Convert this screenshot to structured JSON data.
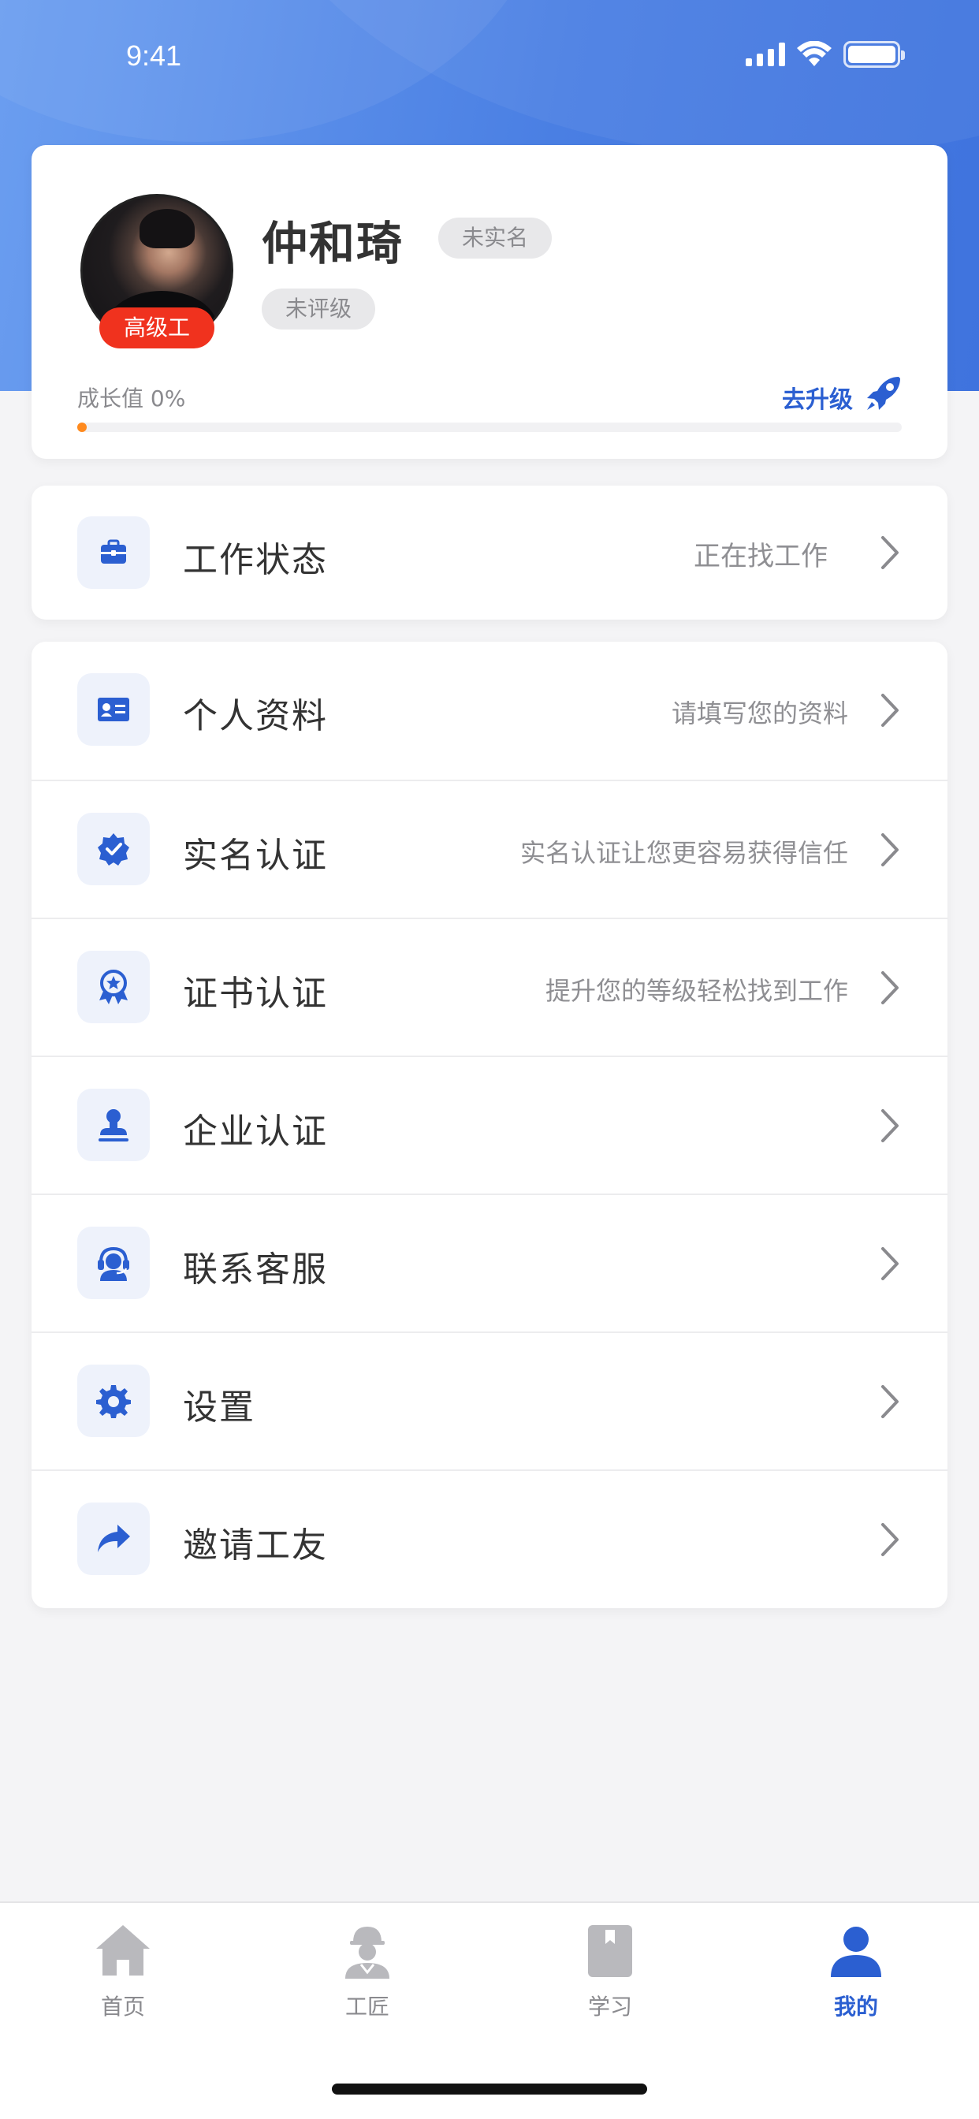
{
  "status_bar": {
    "time": "9:41"
  },
  "profile": {
    "name": "仲和琦",
    "level_badge": "高级工",
    "verify_tag": "未实名",
    "rating_tag": "未评级",
    "growth_label": "成长值 0%",
    "growth_progress": 0,
    "upgrade_label": "去升级"
  },
  "work_status": {
    "label": "工作状态",
    "value": "正在找工作",
    "icon": "briefcase-icon"
  },
  "menu": [
    {
      "label": "个人资料",
      "value": "请填写您的资料",
      "icon": "id-card-icon"
    },
    {
      "label": "实名认证",
      "value": "实名认证让您更容易获得信任",
      "icon": "verified-badge-icon"
    },
    {
      "label": "证书认证",
      "value": "提升您的等级轻松找到工作",
      "icon": "award-ribbon-icon"
    },
    {
      "label": "企业认证",
      "value": "",
      "icon": "stamp-icon"
    },
    {
      "label": "联系客服",
      "value": "",
      "icon": "headset-icon"
    },
    {
      "label": "设置",
      "value": "",
      "icon": "gear-icon"
    },
    {
      "label": "邀请工友",
      "value": "",
      "icon": "share-arrow-icon"
    }
  ],
  "tab_bar": {
    "tabs": [
      {
        "label": "首页",
        "icon": "home-icon"
      },
      {
        "label": "工匠",
        "icon": "worker-icon"
      },
      {
        "label": "学习",
        "icon": "book-icon"
      },
      {
        "label": "我的",
        "icon": "user-icon"
      }
    ],
    "active_index": 3
  },
  "colors": {
    "accent": "#2b5fd1",
    "header_gradient_start": "#6b9ef0",
    "header_gradient_end": "#3f73de",
    "badge_red": "#f0321e",
    "progress_orange": "#ff8a1e"
  }
}
